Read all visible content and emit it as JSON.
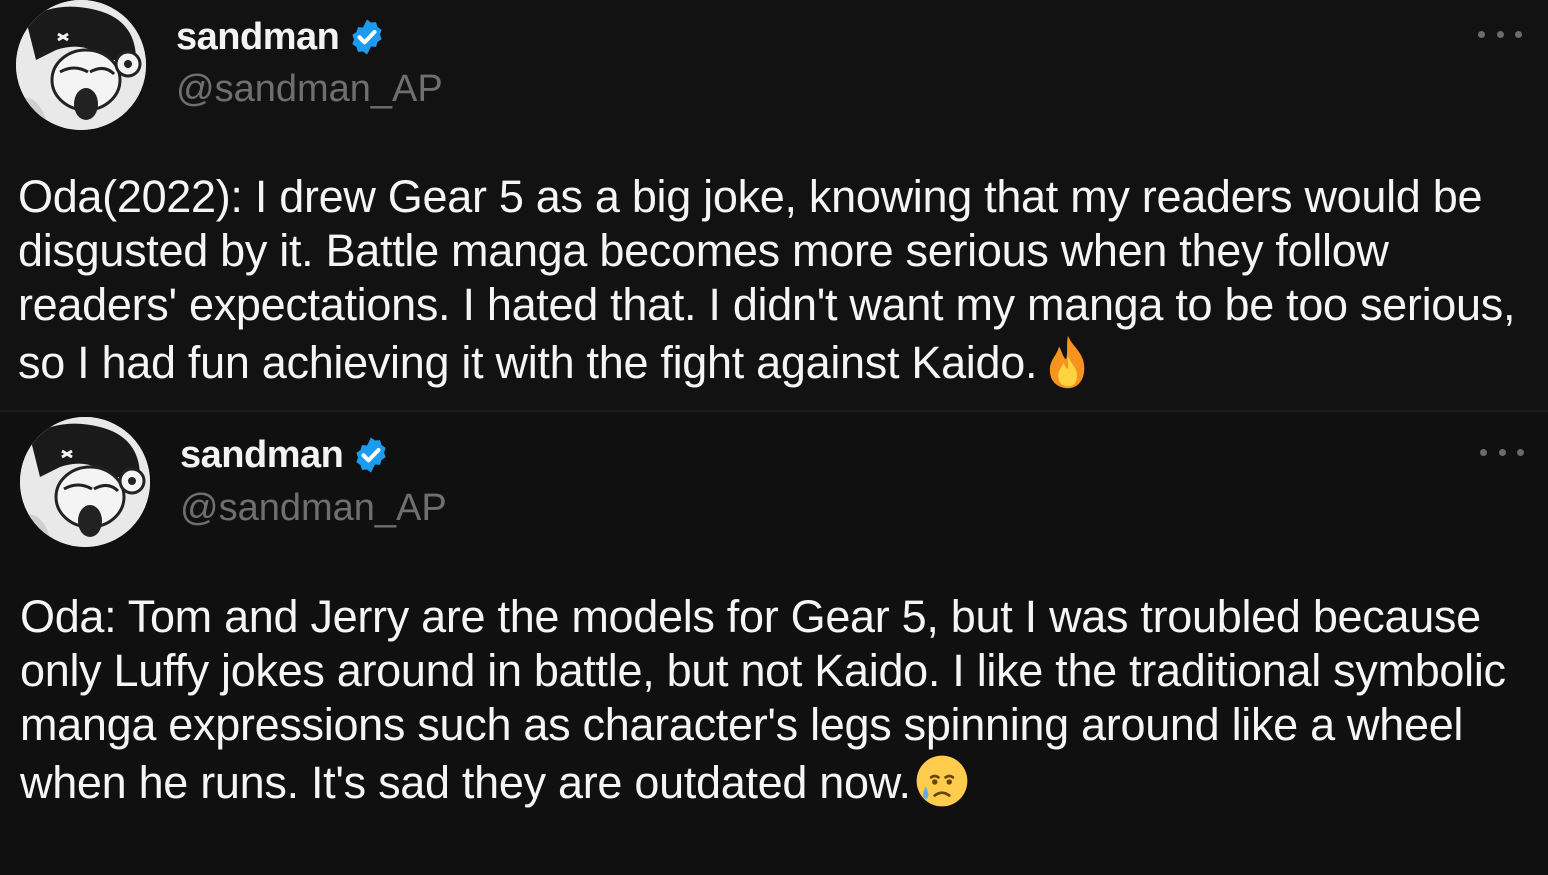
{
  "tweets": [
    {
      "author": {
        "display_name": "sandman",
        "handle": "@sandman_AP",
        "verified": true
      },
      "more_icon": "more-horizontal-icon",
      "text": "Oda(2022): I drew Gear 5 as a big joke, knowing that my readers would be disgusted by it. Battle manga becomes more serious when they follow readers' expectations. I hated that. I didn't want my manga to be too serious, so I had fun achieving it with the fight against Kaido.",
      "emoji": "fire-emoji"
    },
    {
      "author": {
        "display_name": "sandman",
        "handle": "@sandman_AP",
        "verified": true
      },
      "more_icon": "more-horizontal-icon",
      "text": "Oda: Tom and Jerry are the models for Gear 5, but I was troubled because only Luffy jokes around in battle, but not Kaido. I like the traditional symbolic manga expressions such as character's legs spinning around like a wheel when he runs. It's sad they are outdated now.",
      "emoji": "sad-but-relieved-emoji"
    }
  ],
  "colors": {
    "background": "#121212",
    "text": "#f5f5f5",
    "handle": "#6f6f6f",
    "verified_badge": "#1d9bf0",
    "more_dots": "#6b6b6b"
  }
}
